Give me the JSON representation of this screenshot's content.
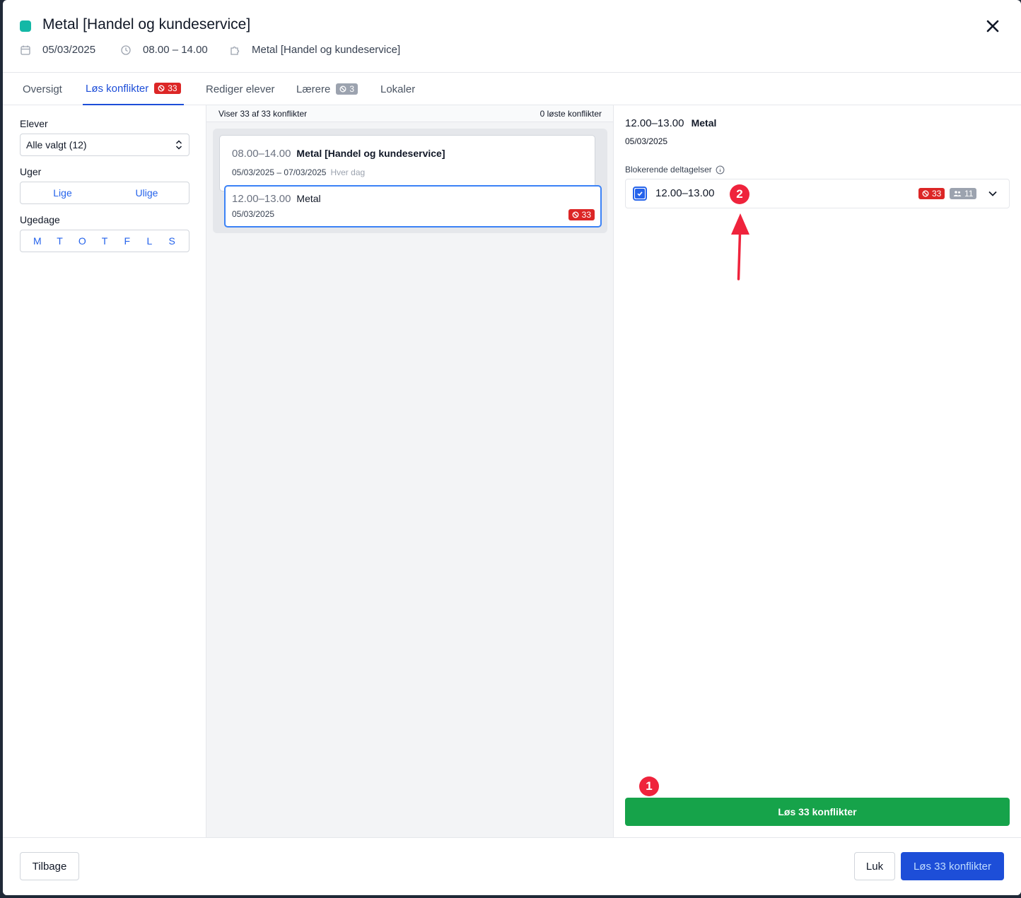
{
  "header": {
    "title": "Metal [Handel og kundeservice]",
    "date": "05/03/2025",
    "time": "08.00 – 14.00",
    "subject": "Metal [Handel og kundeservice]",
    "color": "#14b8a6"
  },
  "tabs": [
    {
      "label": "Oversigt"
    },
    {
      "label": "Løs konflikter",
      "badge": "33"
    },
    {
      "label": "Rediger elever"
    },
    {
      "label": "Lærere",
      "badge": "3"
    },
    {
      "label": "Lokaler"
    }
  ],
  "filters": {
    "students_label": "Elever",
    "students_value": "Alle valgt (12)",
    "weeks_label": "Uger",
    "weeks": [
      "Lige",
      "Ulige"
    ],
    "weekdays_label": "Ugedage",
    "weekdays": [
      "M",
      "T",
      "O",
      "T",
      "F",
      "L",
      "S"
    ]
  },
  "conflicts": {
    "showing": "Viser 33 af 33 konflikter",
    "resolved": "0 løste konflikter",
    "main_card": {
      "time": "08.00–14.00",
      "name": "Metal [Handel og kundeservice]",
      "range": "05/03/2025 – 07/03/2025",
      "recurrence": "Hver dag"
    },
    "item_card": {
      "time": "12.00–13.00",
      "name": "Metal",
      "date": "05/03/2025",
      "badge": "33"
    }
  },
  "detail": {
    "time": "12.00–13.00",
    "name": "Metal",
    "date": "05/03/2025",
    "blocking_label": "Blokerende deltagelser",
    "blocking_item": {
      "time": "12.00–13.00",
      "conflicts_badge": "33",
      "people_badge": "11",
      "checked": true
    },
    "resolve_button": "Løs 33 konflikter"
  },
  "annotations": {
    "marker_1": "1",
    "marker_2": "2",
    "color": "#ef233c"
  },
  "footer": {
    "back": "Tilbage",
    "close": "Luk",
    "resolve": "Løs 33 konflikter"
  }
}
